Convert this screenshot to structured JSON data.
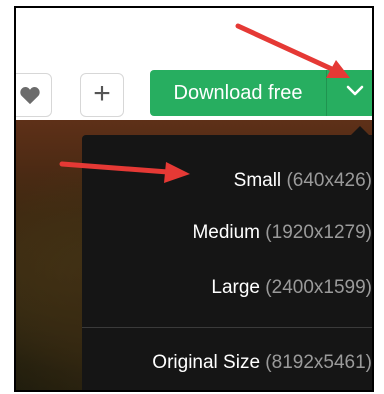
{
  "toolbar": {
    "heart_icon": "heart-icon",
    "plus_icon": "plus-icon",
    "plus_glyph": "+",
    "download_label": "Download free",
    "dropdown_icon": "chevron-down-icon"
  },
  "menu": {
    "items": [
      {
        "name": "Small",
        "size": "(640x426)"
      },
      {
        "name": "Medium",
        "size": "(1920x1279)"
      },
      {
        "name": "Large",
        "size": "(2400x1599)"
      },
      {
        "name": "Original Size",
        "size": "(8192x5461)"
      }
    ]
  },
  "colors": {
    "accent_green": "#27ae60",
    "menu_bg": "#151515",
    "annotation_arrow": "#e53935"
  }
}
